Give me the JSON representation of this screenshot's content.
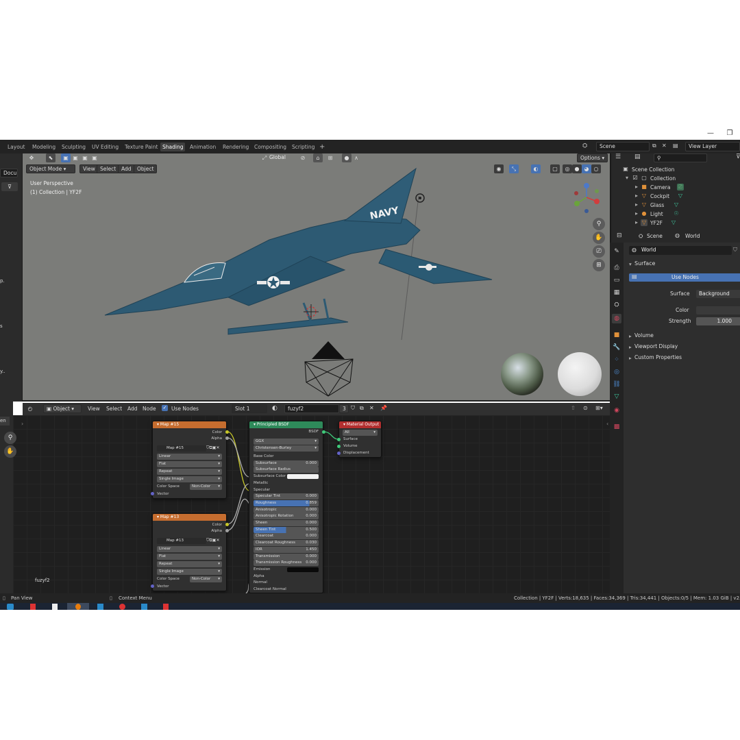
{
  "workspaces": [
    "Layout",
    "Modeling",
    "Sculpting",
    "UV Editing",
    "Texture Paint",
    "Shading",
    "Animation",
    "Rendering",
    "Compositing",
    "Scripting"
  ],
  "active_workspace": "Shading",
  "add_workspace": "+",
  "scene_field": "Scene",
  "view_layer_field": "View Layer",
  "left_strip": {
    "top_label": "Docu",
    "hint1": "p.",
    "hint2": "s",
    "hint3": "y..",
    "label_en": "en"
  },
  "viewport": {
    "mode": "Object Mode",
    "menus": [
      "View",
      "Select",
      "Add",
      "Object"
    ],
    "transform": "Global",
    "options": "Options",
    "perspective": "User Perspective",
    "collection_info": "(1) Collection | YF2F",
    "aircraft_text": "NAVY"
  },
  "outliner": {
    "root": "Scene Collection",
    "collection": "Collection",
    "items": [
      "Camera",
      "Cockpit",
      "Glass",
      "Light",
      "YF2F"
    ]
  },
  "properties": {
    "scene_tab": "Scene",
    "world_tab": "World",
    "world_name": "World",
    "surface_panel": "Surface",
    "use_nodes_button": "Use Nodes",
    "surface_label": "Surface",
    "surface_value": "Background",
    "color_label": "Color",
    "strength_label": "Strength",
    "strength_value": "1.000",
    "panels": [
      "Volume",
      "Viewport Display",
      "Custom Properties"
    ]
  },
  "node_editor": {
    "object_menu": "Object",
    "menus": [
      "View",
      "Select",
      "Add",
      "Node"
    ],
    "use_nodes": "Use Nodes",
    "slot": "Slot 1",
    "material": "fuzyf2",
    "users": "3",
    "material_label": "fuzyf2"
  },
  "nodes": {
    "map15": {
      "title": "Map #15",
      "out_color": "Color",
      "out_alpha": "Alpha",
      "image": "Map #15",
      "interp": "Linear",
      "proj": "Flat",
      "ext": "Repeat",
      "src": "Single Image",
      "cs_label": "Color Space",
      "cs_value": "Non-Color",
      "in_vector": "Vector"
    },
    "map13": {
      "title": "Map #13",
      "out_color": "Color",
      "out_alpha": "Alpha",
      "image": "Map #13",
      "interp": "Linear",
      "proj": "Flat",
      "ext": "Repeat",
      "src": "Single Image",
      "cs_label": "Color Space",
      "cs_value": "Non-Color",
      "in_vector": "Vector"
    },
    "bsdf": {
      "title": "Principled BSDF",
      "out": "BSDF",
      "dist": "GGX",
      "sss_method": "Christensen-Burley",
      "rows": [
        {
          "label": "Base Color",
          "value": "",
          "kind": "socket"
        },
        {
          "label": "Subsurface",
          "value": "0.000",
          "kind": "field"
        },
        {
          "label": "Subsurface Radius",
          "value": "",
          "kind": "field"
        },
        {
          "label": "Subsurface Color",
          "value": "",
          "kind": "color"
        },
        {
          "label": "Metallic",
          "value": "",
          "kind": "socket"
        },
        {
          "label": "Specular",
          "value": "",
          "kind": "socket"
        },
        {
          "label": "Specular Tint",
          "value": "0.000",
          "kind": "field"
        },
        {
          "label": "Roughness",
          "value": "0.859",
          "kind": "fillfield"
        },
        {
          "label": "Anisotropic",
          "value": "0.000",
          "kind": "field"
        },
        {
          "label": "Anisotropic Rotation",
          "value": "0.000",
          "kind": "field"
        },
        {
          "label": "Sheen",
          "value": "0.000",
          "kind": "field"
        },
        {
          "label": "Sheen Tint",
          "value": "0.500",
          "kind": "halffield"
        },
        {
          "label": "Clearcoat",
          "value": "0.000",
          "kind": "field"
        },
        {
          "label": "Clearcoat Roughness",
          "value": "0.030",
          "kind": "field"
        },
        {
          "label": "IOR",
          "value": "1.450",
          "kind": "field"
        },
        {
          "label": "Transmission",
          "value": "0.000",
          "kind": "field"
        },
        {
          "label": "Transmission Roughness",
          "value": "0.000",
          "kind": "field"
        },
        {
          "label": "Emission",
          "value": "",
          "kind": "blackcolor"
        },
        {
          "label": "Alpha",
          "value": "",
          "kind": "socket"
        },
        {
          "label": "Normal",
          "value": "",
          "kind": "socket"
        },
        {
          "label": "Clearcoat Normal",
          "value": "",
          "kind": "socket"
        }
      ]
    },
    "output": {
      "title": "Material Output",
      "target": "All",
      "inputs": [
        "Surface",
        "Volume",
        "Displacement"
      ]
    }
  },
  "statusbar": {
    "left1": "Pan View",
    "left2": "Context Menu",
    "right": "Collection | YF2F | Verts:18,635 | Faces:34,369 | Tris:34,441 | Objects:0/5 | Mem: 1.03 GiB | v2.81"
  },
  "colors": {
    "accent_blue": "#4772b3",
    "texture_node_header": "#c66d2f",
    "shader_node_header": "#2e8a5a",
    "output_node_header": "#b32f2f",
    "viewport_bg": "#7b7c79",
    "aircraft": "#2d5a73"
  }
}
